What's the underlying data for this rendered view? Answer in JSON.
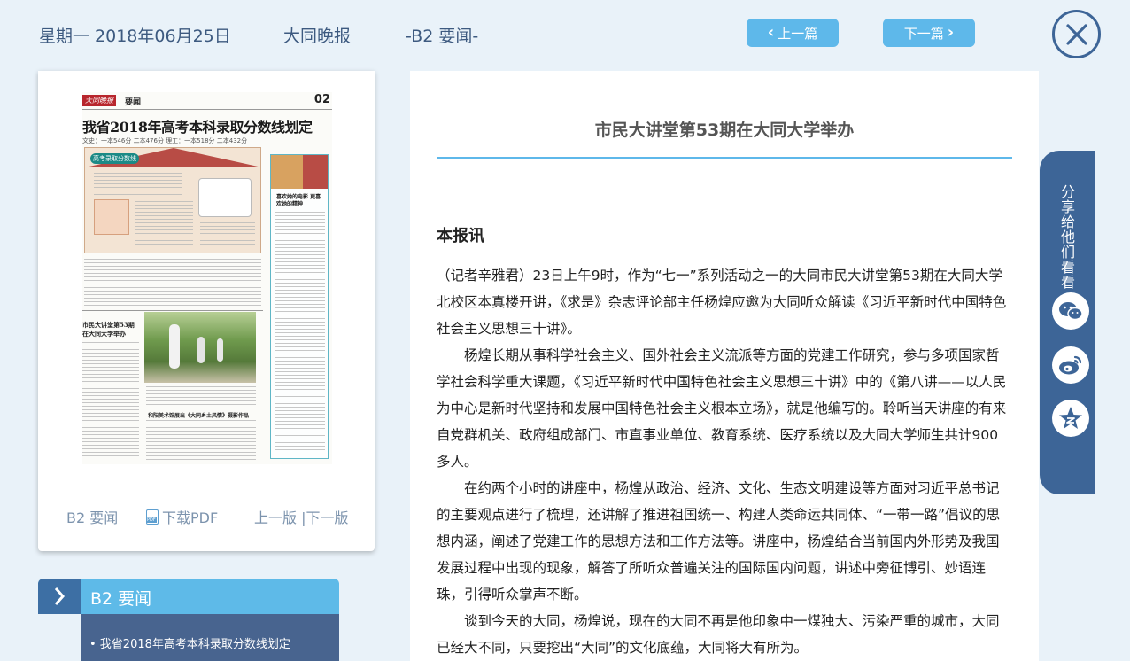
{
  "header": {
    "date": "星期一 2018年06月25日",
    "paper": "大同晚报",
    "section": "-B2 要闻-",
    "prev_label": "上一篇",
    "next_label": "下一篇"
  },
  "page_card": {
    "newspaper": {
      "logo": "大同晚报",
      "section": "要闻",
      "page_no": "02",
      "headline": "我省2018年高考本科录取分数线划定",
      "subline": "文史：一本546分 二本476分   理工：一本518分 二本432分",
      "info_label": "高考录取分数线",
      "side_headline": "喜欢她的电影 更喜欢她的精神",
      "article2_headline": "市民大讲堂第53期在大同大学举办",
      "article3_headline": "和阳美术馆展出《大同乡土风情》摄影作品"
    },
    "footer": {
      "section": "B2 要闻",
      "download": "下载PDF",
      "prev_next": "上一版 |下一版"
    }
  },
  "section_nav": {
    "title": "B2  要闻",
    "items": [
      "• 我省2018年高考本科录取分数线划定"
    ]
  },
  "article": {
    "title": "市民大讲堂第53期在大同大学举办",
    "lead": "本报讯",
    "paragraphs": [
      "（记者辛雅君）23日上午9时，作为“七一”系列活动之一的大同市民大讲堂第53期在大同大学北校区本真楼开讲，《求是》杂志评论部主任杨煌应邀为大同听众解读《习近平新时代中国特色社会主义思想三十讲》。",
      "杨煌长期从事科学社会主义、国外社会主义流派等方面的党建工作研究，参与多项国家哲学社会科学重大课题，《习近平新时代中国特色社会主义思想三十讲》中的《第八讲——以人民为中心是新时代坚持和发展中国特色社会主义根本立场》，就是他编写的。聆听当天讲座的有来自党群机关、政府组成部门、市直事业单位、教育系统、医疗系统以及大同大学师生共计900多人。",
      "在约两个小时的讲座中，杨煌从政治、经济、文化、生态文明建设等方面对习近平总书记的主要观点进行了梳理，还讲解了推进祖国统一、构建人类命运共同体、“一带一路”倡议的思想内涵，阐述了党建工作的思想方法和工作方法等。讲座中，杨煌结合当前国内外形势及我国发展过程中出现的现象，解答了所听众普遍关注的国际国内问题，讲述中旁征博引、妙语连珠，引得听众掌声不断。",
      "谈到今天的大同，杨煌说，现在的大同不再是他印象中一煤独大、污染严重的城市，大同已经大不同，只要挖出“大同”的文化底蕴，大同将大有所为。"
    ]
  },
  "share": {
    "label": "分享给他们看看",
    "buttons": [
      "wechat-icon",
      "weibo-icon",
      "qzone-icon"
    ]
  },
  "colors": {
    "background": "#e9f2f9",
    "accent": "#5eb8ea",
    "dark_blue": "#3d6597"
  }
}
